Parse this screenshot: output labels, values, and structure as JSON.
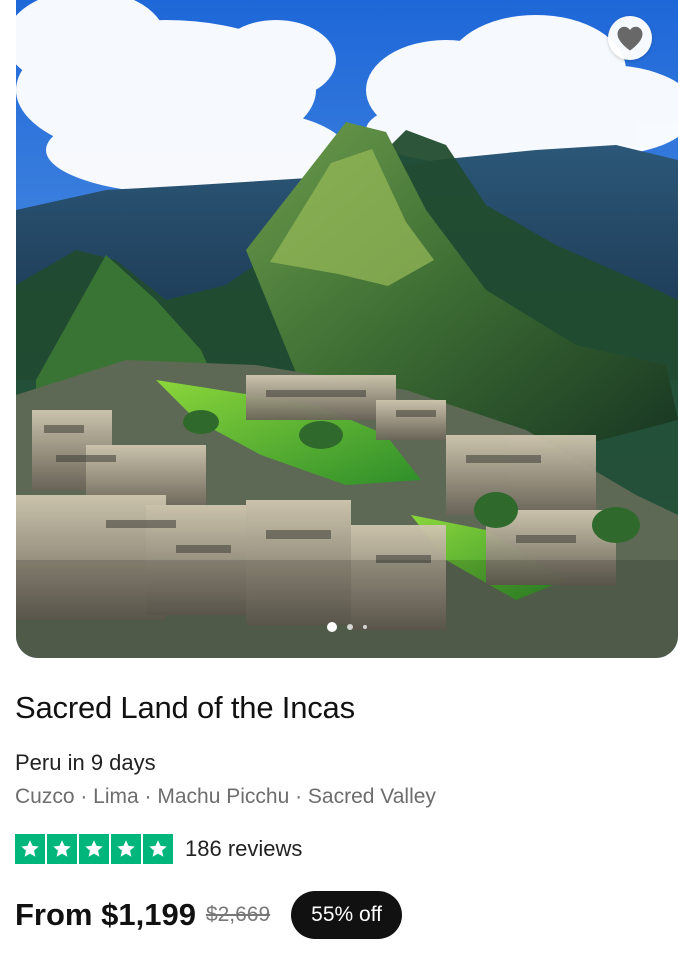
{
  "tour": {
    "title": "Sacred Land of the Incas",
    "subtitle": "Peru in 9 days",
    "places_text": "Cuzco · Lima · Machu Picchu · Sacred Valley",
    "rating": {
      "stars": 5,
      "max_stars": 5,
      "reviews_text": "186 reviews",
      "star_color": "#00b67a"
    },
    "price_text": "From $1,199",
    "original_price_text": "$2,669",
    "discount_text": "55% off"
  },
  "gallery": {
    "image_subject": "Machu Picchu mountain ruins",
    "current_index": 1,
    "total_images": 3,
    "favorite_icon": "heart-icon"
  }
}
